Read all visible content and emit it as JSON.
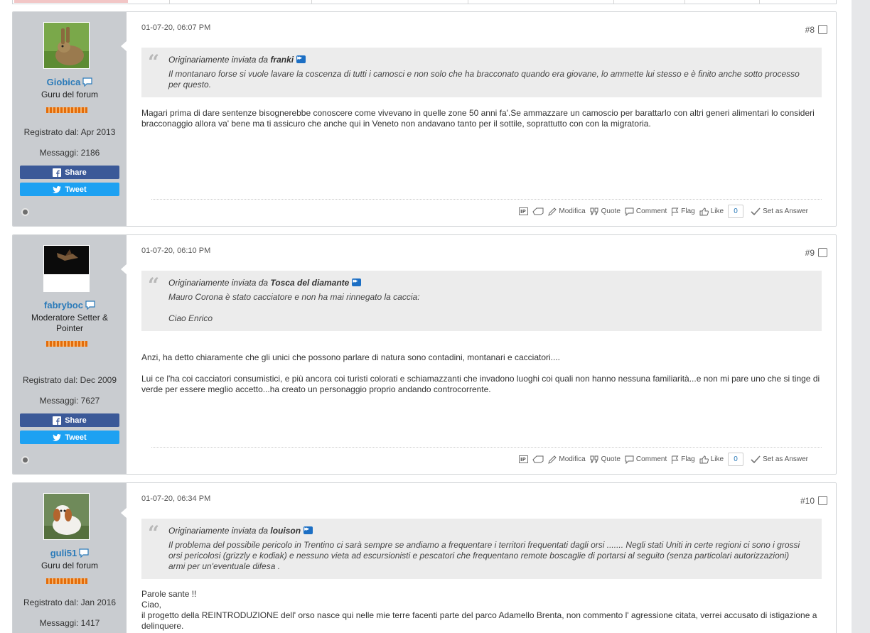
{
  "colors": {
    "accent": "#2a7ab9",
    "sidebar": "#c9ccd0",
    "facebook": "#3b5998",
    "twitter": "#1da1f2",
    "reputation": "#e36c0a",
    "quote_bg": "#ececec"
  },
  "share_label": "Share",
  "tweet_label": "Tweet",
  "actions": {
    "modifica": "Modifica",
    "quote": "Quote",
    "comment": "Comment",
    "flag": "Flag",
    "like": "Like",
    "set_answer": "Set as Answer"
  },
  "quote_prefix": "Originariamente inviata da",
  "posts": [
    {
      "date": "01-07-20, 06:07 PM",
      "number": "#8",
      "user": {
        "name": "Giobica",
        "title": "Guru del forum",
        "joined": "Registrato dal: Apr 2013",
        "messages": "Messaggi: 2186"
      },
      "quote": {
        "author": "franki",
        "lines": [
          "Il montanaro forse si vuole lavare la coscenza di tutti i camosci e non solo che ha bracconato quando era giovane, lo ammette lui stesso e è finito anche sotto processo per questo."
        ]
      },
      "body": [
        "Magari prima di dare sentenze bisognerebbe conoscere come vivevano in quelle zone 50 anni fa'.Se ammazzare un camoscio per barattarlo con altri generi alimentari lo consideri bracconaggio allora va' bene ma ti assicuro che anche qui in Veneto non andavano tanto per il sottile, soprattutto con con la migratoria."
      ],
      "likes": "0"
    },
    {
      "date": "01-07-20, 06:10 PM",
      "number": "#9",
      "user": {
        "name": "fabryboc",
        "title": "Moderatore Setter & Pointer",
        "joined": "Registrato dal: Dec 2009",
        "messages": "Messaggi: 7627"
      },
      "quote": {
        "author": "Tosca del diamante",
        "lines": [
          "Mauro Corona è stato cacciatore e non ha mai rinnegato la caccia:",
          "Ciao Enrico"
        ]
      },
      "body": [
        "Anzi, ha detto chiaramente che gli unici che possono parlare di natura sono contadini, montanari e cacciatori....",
        "Lui ce l'ha coi cacciatori consumistici, e più ancora coi turisti colorati e schiamazzanti che invadono luoghi coi quali non hanno nessuna familiarità...e non mi pare uno che si tinge di verde per essere meglio accetto...ha creato un personaggio proprio andando controcorrente."
      ],
      "likes": "0"
    },
    {
      "date": "01-07-20, 06:34 PM",
      "number": "#10",
      "user": {
        "name": "guli51",
        "title": "Guru del forum",
        "joined": "Registrato dal: Jan 2016",
        "messages": "Messaggi: 1417"
      },
      "quote": {
        "author": "louison",
        "lines": [
          "Il problema del possibile pericolo in Trentino ci sarà sempre se andiamo a frequentare i territori frequentati dagli orsi ....... Negli stati Uniti in certe regioni ci sono i grossi orsi pericolosi (grizzly e kodiak) e nessuno vieta ad escursionisti e pescatori che frequentano remote boscaglie di portarsi al seguito (senza particolari autorizzazioni) armi per un'eventuale difesa ."
        ]
      },
      "body": [
        "Parole sante !!",
        "Ciao,",
        "il progetto della REINTRODUZIONE dell' orso nasce qui nelle mie terre facenti parte del parco Adamello Brenta, non commento l' agressione citata, verrei accusato di istigazione a delinquere."
      ]
    }
  ]
}
